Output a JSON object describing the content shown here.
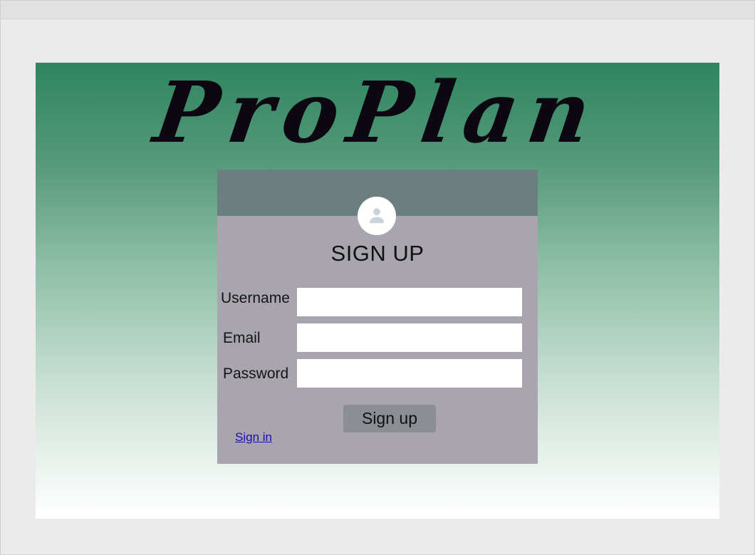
{
  "app": {
    "brand_title": "ProPlan"
  },
  "signup_card": {
    "title": "SIGN UP",
    "avatar_icon": "user-icon",
    "fields": {
      "username": {
        "label": "Username",
        "value": "",
        "placeholder": ""
      },
      "email": {
        "label": "Email",
        "value": "",
        "placeholder": ""
      },
      "password": {
        "label": "Password",
        "value": "",
        "placeholder": ""
      }
    },
    "submit_label": "Sign up",
    "signin_link_label": "Sign in"
  },
  "colors": {
    "gradient_top": "#2e8560",
    "gradient_bottom": "#ffffff",
    "card_background": "#a8a5ae",
    "card_header": "#6b7f81",
    "button_background": "#8c8e95",
    "link_color": "#1a0dab"
  }
}
